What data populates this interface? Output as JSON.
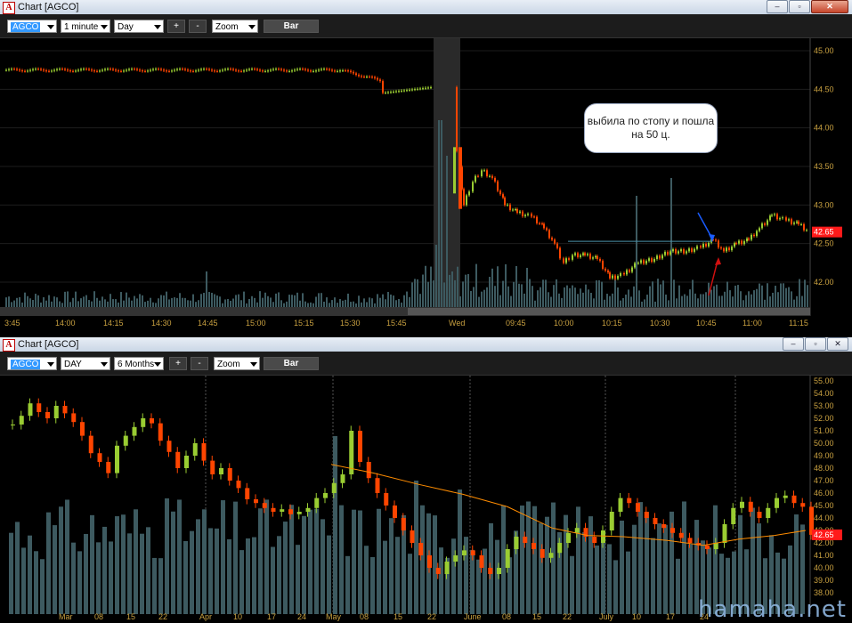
{
  "colors": {
    "up": "#9acd32",
    "down": "#ff4500",
    "volume": "#3d5a60",
    "ma": "#ff8c00",
    "axis_text": "#c8a040",
    "last_price_bg": "#ff1a1a"
  },
  "chart1": {
    "title": "Chart [AGCO]",
    "toolbar": {
      "symbol": "AGCO",
      "interval": "1 minute",
      "range": "Day",
      "plus": "+",
      "minus": "-",
      "zoom": "Zoom",
      "style": "Bar"
    },
    "y_ticks": [
      "45.00",
      "44.50",
      "44.00",
      "43.50",
      "43.00",
      "42.50",
      "42.00"
    ],
    "x_ticks": [
      "3:45",
      "14:00",
      "14:15",
      "14:30",
      "14:45",
      "15:00",
      "15:15",
      "15:30",
      "15:45",
      "Wed",
      "09:45",
      "10:00",
      "10:15",
      "10:30",
      "10:45",
      "11:00",
      "11:15"
    ],
    "last_price": "42.65",
    "annotation": "выбила по стопу и пошла на 50 ц."
  },
  "chart2": {
    "title": "Chart [AGCO]",
    "toolbar": {
      "symbol": "AGCO",
      "interval": "DAY",
      "range": "6 Months",
      "plus": "+",
      "minus": "-",
      "zoom": "Zoom",
      "style": "Bar"
    },
    "y_ticks": [
      "55.00",
      "54.00",
      "53.00",
      "52.00",
      "51.00",
      "50.00",
      "49.00",
      "48.00",
      "47.00",
      "46.00",
      "45.00",
      "44.00",
      "43.00",
      "42.00",
      "41.00",
      "40.00",
      "39.00",
      "38.00"
    ],
    "x_ticks": [
      "Mar",
      "08",
      "15",
      "22",
      "Apr",
      "10",
      "17",
      "24",
      "May",
      "08",
      "15",
      "22",
      "June",
      "08",
      "15",
      "22",
      "July",
      "10",
      "17",
      "24"
    ],
    "last_price": "42.65"
  },
  "watermark": "hamaha.net",
  "window_buttons": {
    "minimize": "–",
    "restore": "▫",
    "close": "✕"
  }
}
